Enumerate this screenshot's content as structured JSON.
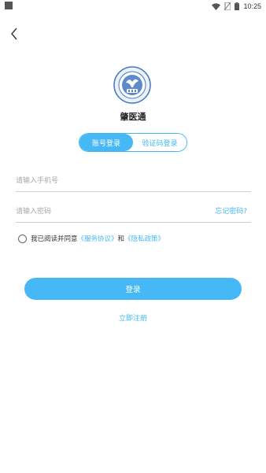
{
  "status_bar": {
    "time": "10:25"
  },
  "app": {
    "title": "肇医通"
  },
  "tabs": [
    {
      "label": "账号登录",
      "active": true
    },
    {
      "label": "验证码登录",
      "active": false
    }
  ],
  "form": {
    "phone_placeholder": "请输入手机号",
    "password_placeholder": "请输入密码",
    "forgot_label": "忘记密码?"
  },
  "agreement": {
    "prefix": "我已阅读并同意",
    "service_link": "《服务协议》",
    "and": "和",
    "privacy_link": "《隐私政策》"
  },
  "actions": {
    "login_label": "登录",
    "register_label": "立即注册"
  },
  "colors": {
    "accent": "#46b8f5"
  }
}
